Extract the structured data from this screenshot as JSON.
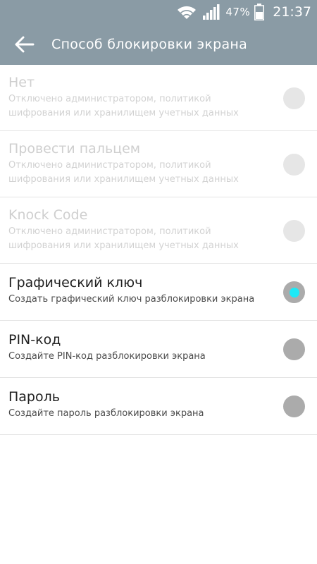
{
  "status_bar": {
    "wifi_icon": "wifi-icon",
    "signal_icon": "signal-icon",
    "battery_percent": "47%",
    "battery_icon": "battery-icon",
    "time": "21:37"
  },
  "app_bar": {
    "back_icon": "arrow-back-icon",
    "title": "Способ блокировки экрана",
    "background_color": "#8a9ba5"
  },
  "options": [
    {
      "label": "Нет",
      "description": "Отключено администратором, политикой шифрования или хранилищем учетных данных",
      "enabled": false,
      "selected": false
    },
    {
      "label": "Провести пальцем",
      "description": "Отключено администратором, политикой шифрования или хранилищем учетных данных",
      "enabled": false,
      "selected": false
    },
    {
      "label": "Knock Code",
      "description": "Отключено администратором, политикой шифрования или хранилищем учетных данных",
      "enabled": false,
      "selected": false
    },
    {
      "label": "Графический ключ",
      "description": "Создать графический ключ разблокировки экрана",
      "enabled": true,
      "selected": true
    },
    {
      "label": "PIN-код",
      "description": "Создайте PIN-код разблокировки экрана",
      "enabled": true,
      "selected": false
    },
    {
      "label": "Пароль",
      "description": "Создайте пароль разблокировки экрана",
      "enabled": true,
      "selected": false
    }
  ],
  "colors": {
    "accent": "#1de9f6",
    "radio_off": "#ababab",
    "radio_disabled": "#e6e6e6"
  }
}
